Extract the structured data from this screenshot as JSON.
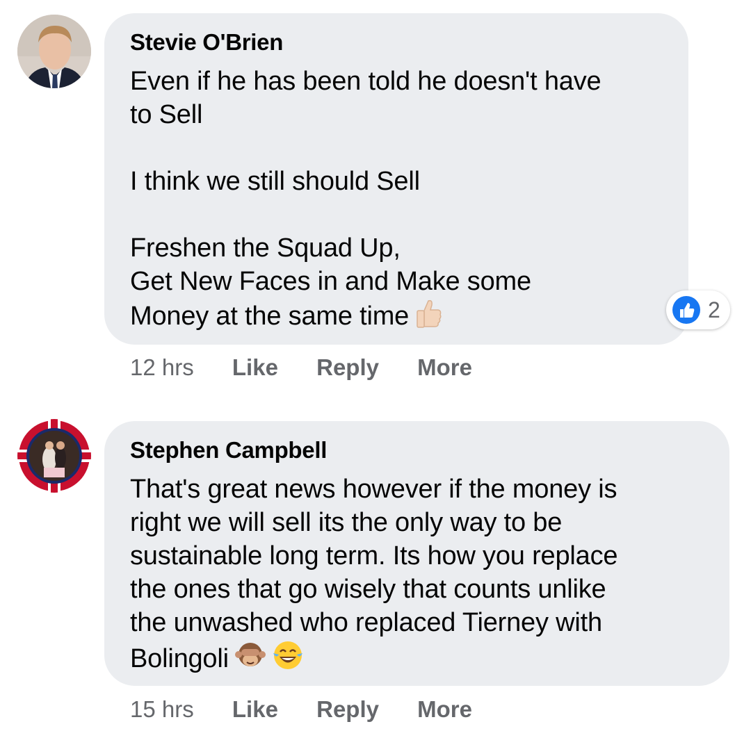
{
  "comments": [
    {
      "author": "Stevie O'Brien",
      "text": "Even if he has been told he doesn't have\nto Sell\n\nI think we still should Sell\n\nFreshen the Squad Up,\nGet New Faces in and Make some\nMoney at the same time",
      "emoji": "thumbs-up-light-skin",
      "reaction_icon": "like-icon",
      "reaction_count": "2",
      "time": "12 hrs",
      "like_label": "Like",
      "reply_label": "Reply",
      "more_label": "More"
    },
    {
      "author": "Stephen Campbell",
      "text": "That's great news however if the money is\nright we will sell its the only way to be\nsustainable long term. Its how you replace\nthe ones that go wisely that counts unlike\nthe unwashed who replaced Tierney with\nBolingoli",
      "emojis": [
        "see-no-evil-monkey",
        "tears-of-joy"
      ],
      "time": "15 hrs",
      "like_label": "Like",
      "reply_label": "Reply",
      "more_label": "More"
    }
  ],
  "colors": {
    "bubble": "#ebedf0",
    "meta_text": "#65676b",
    "like_blue": "#1877f2"
  }
}
